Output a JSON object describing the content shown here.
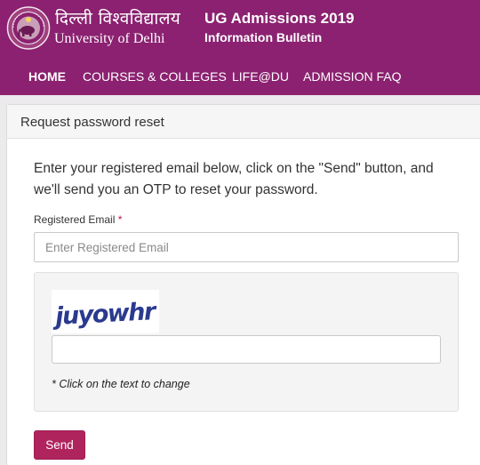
{
  "header": {
    "logo_hindi": "दिल्ली विश्वविद्यालय",
    "logo_english": "University of Delhi",
    "title": "UG Admissions 2019",
    "subtitle": "Information Bulletin",
    "brand_color": "#8b2170"
  },
  "nav": {
    "items": [
      "HOME",
      "COURSES & COLLEGES",
      "LIFE@DU",
      "ADMISSION FAQ"
    ],
    "active": "HOME"
  },
  "panel": {
    "title": "Request password reset",
    "intro": "Enter your registered email below, click on the \"Send\" button, and we'll send you an OTP to reset your password."
  },
  "form": {
    "email_label": "Registered Email",
    "required_mark": "*",
    "email_placeholder": "Enter Registered Email",
    "email_value": "",
    "captcha_text": "juyowhr",
    "captcha_value": "",
    "captcha_hint": "* Click on the text to change",
    "send_label": "Send",
    "button_color": "#b0245e"
  }
}
